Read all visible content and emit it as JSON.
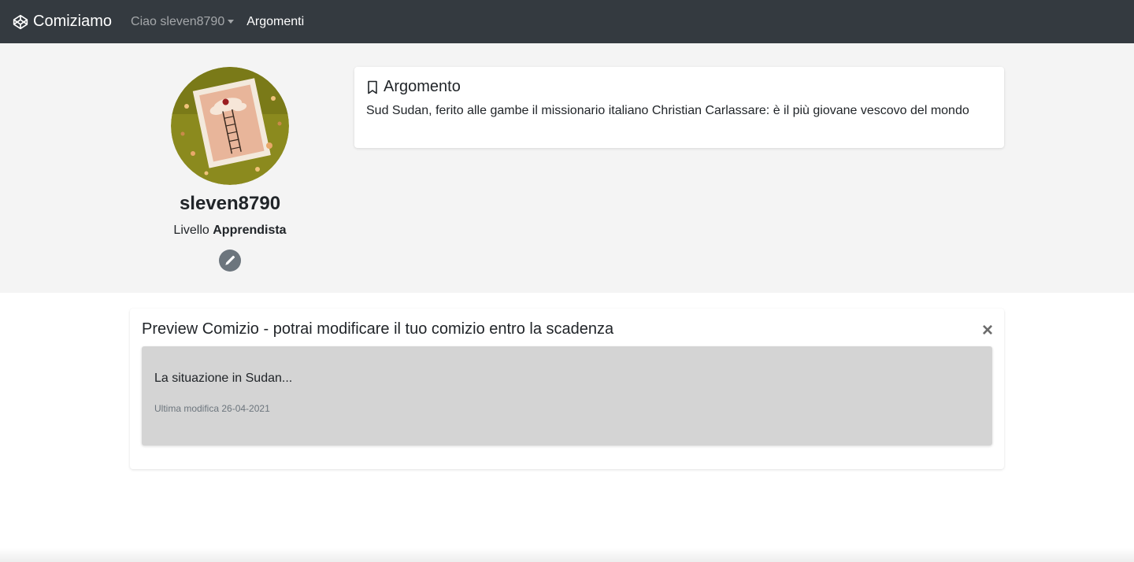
{
  "navbar": {
    "brand": "Comiziamo",
    "user_menu": "Ciao sleven8790",
    "topics_link": "Argomenti"
  },
  "profile": {
    "username": "sleven8790",
    "level_label": "Livello",
    "level_value": "Apprendista",
    "avatar_icon": "user-avatar-illustration",
    "edit_icon": "pencil-icon"
  },
  "topic": {
    "heading": "Argomento",
    "text": "Sud Sudan, ferito alle gambe il missionario italiano Christian Carlassare: è il più giovane vescovo del mondo"
  },
  "preview": {
    "title": "Preview Comizio - potrai modificare il tuo comizio entro la scadenza",
    "close_label": "×",
    "body_text": "La situazione in Sudan...",
    "last_modified": "Ultima modifica 26-04-2021"
  },
  "colors": {
    "navbar_bg": "#343a40",
    "hero_bg": "#f4f4f4",
    "preview_inner_bg": "#d4d4d4",
    "edit_button_bg": "#6c757d"
  }
}
